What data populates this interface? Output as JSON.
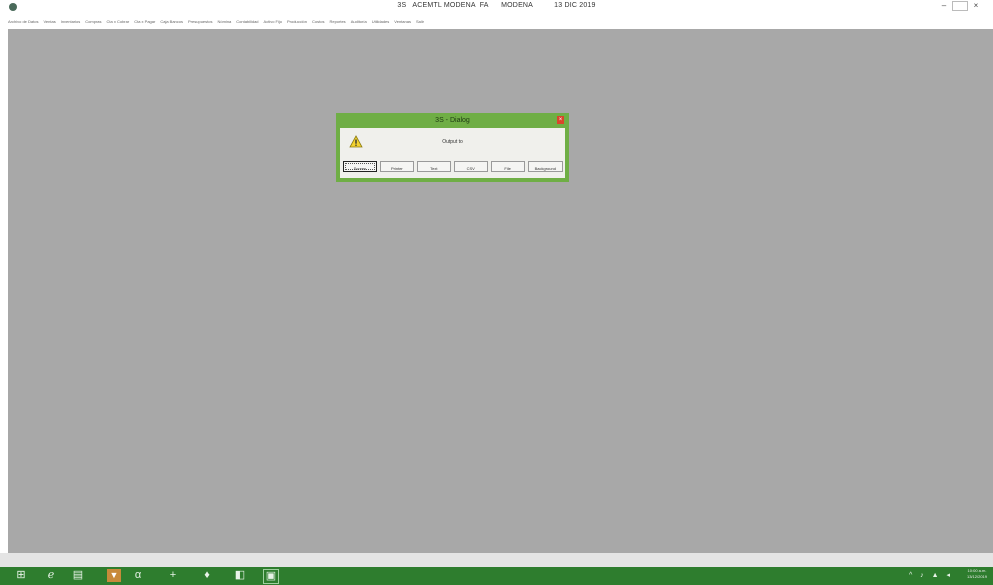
{
  "window": {
    "title": "3S   ACEMTL MODENA  FA      MODENA          13 DIC 2019",
    "controls": {
      "minimize": "–",
      "maximize": "",
      "close": "×"
    }
  },
  "menubar": {
    "items": [
      "Archivo de Datos",
      "Ventas",
      "Inventarios",
      "Compras",
      "Cta x Cobrar",
      "Cta x Pagar",
      "Caja Bancos",
      "Presupuestos",
      "Nómina",
      "Contabilidad",
      "Activo Fijo",
      "Producción",
      "Costos",
      "Reportes",
      "Auditoría",
      "Utilidades",
      "Ventanas",
      "Salir"
    ]
  },
  "dialog": {
    "title": "3S - Dialog",
    "message": "Output to",
    "buttons": [
      "Screen",
      "Printer",
      "Text",
      "CSV",
      "File",
      "Background"
    ]
  },
  "taskbar": {
    "icons": [
      "windows",
      "edge",
      "explorer",
      "app1",
      "app2",
      "app3",
      "app4",
      "app5",
      "app6"
    ],
    "clock": {
      "time": "10:00 a.m.",
      "date": "13/12/2019"
    },
    "tray": "^ ♪ ▲ ◂"
  },
  "colors": {
    "desktop": "#a8a8a8",
    "dialog_frame": "#6fae45",
    "taskbar": "#2e7d2e"
  }
}
